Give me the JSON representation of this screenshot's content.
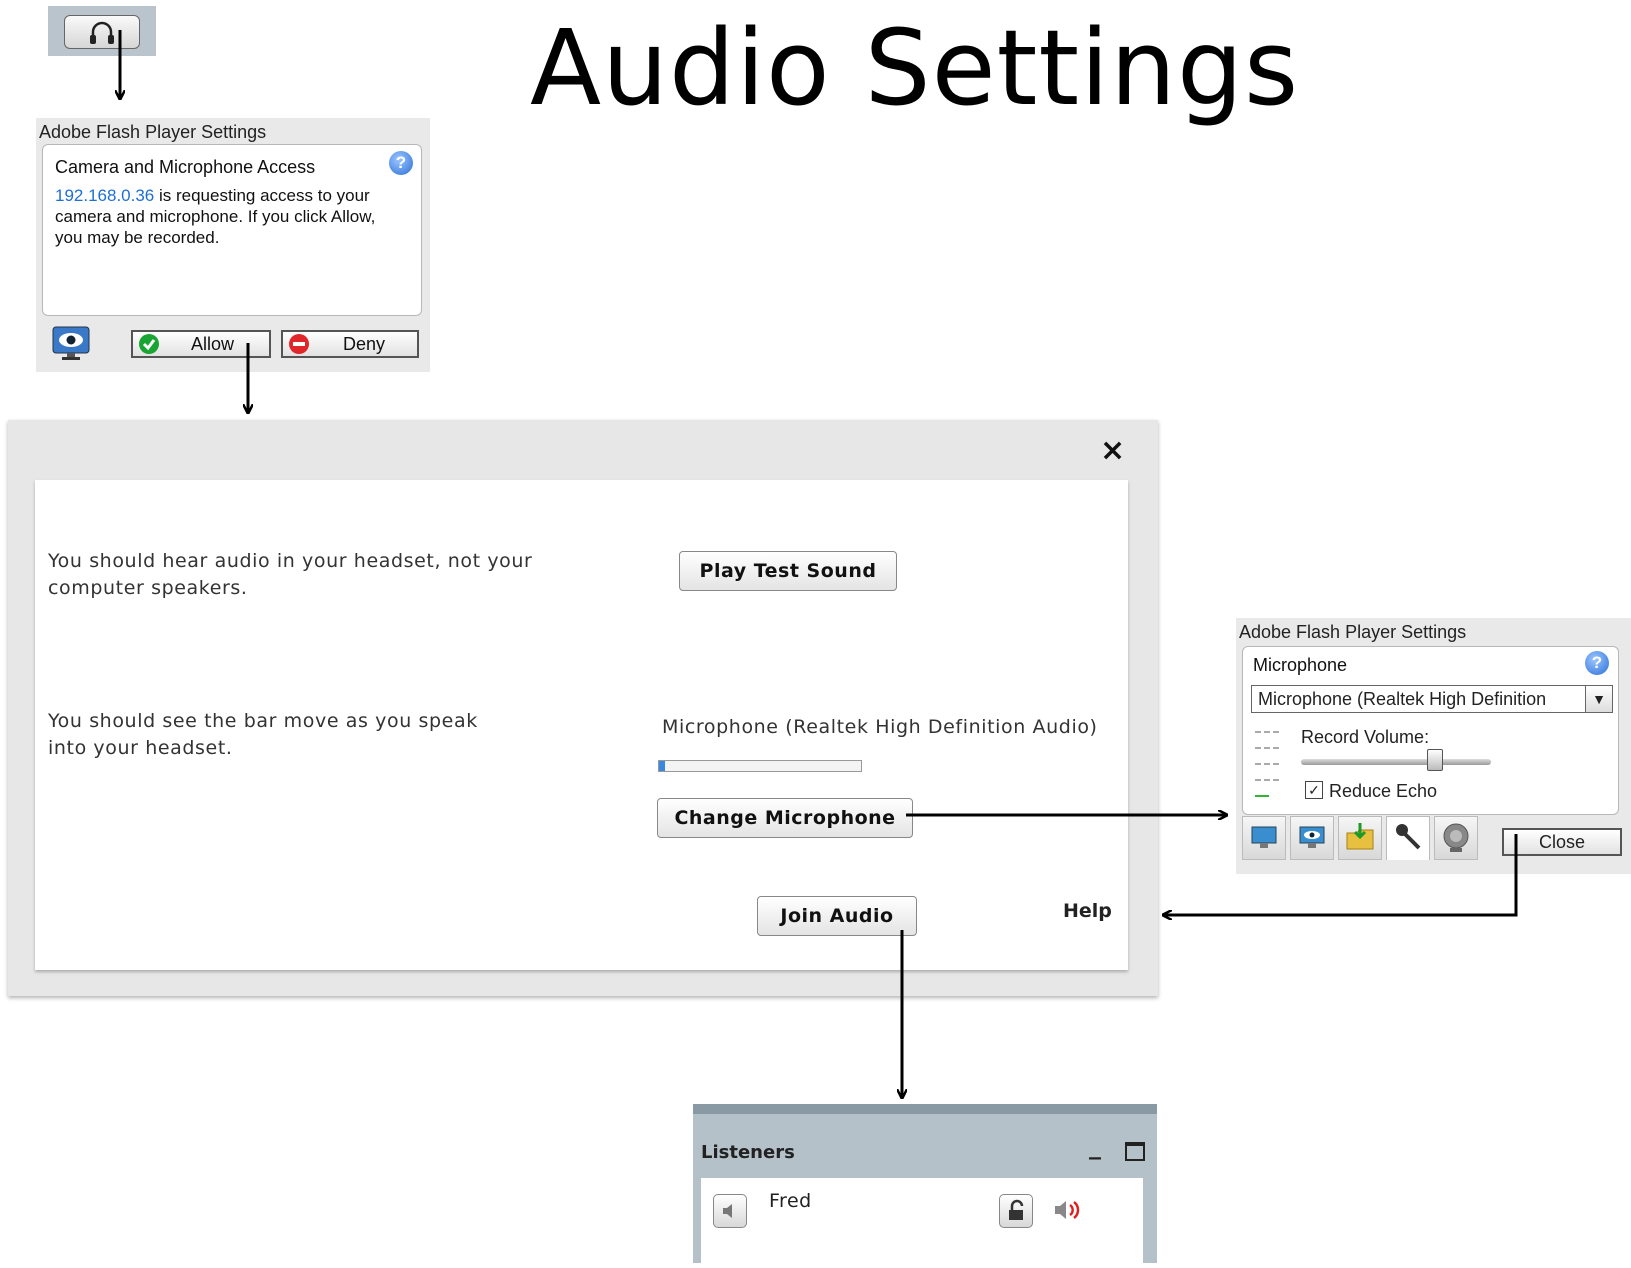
{
  "page": {
    "title": "Audio Settings"
  },
  "flash_access_dialog": {
    "title": "Adobe Flash Player Settings",
    "heading": "Camera and Microphone Access",
    "ip": "192.168.0.36",
    "message_rest": " is requesting access to your camera and microphone. If you click Allow, you may be recorded.",
    "allow_label": "Allow",
    "deny_label": "Deny"
  },
  "audio_dialog": {
    "close_symbol": "×",
    "headset_instruction": "You should hear audio in your headset, not your computer speakers.",
    "play_test_label": "Play Test Sound",
    "speak_instruction": "You should see the bar move as you speak into your headset.",
    "microphone_name": "Microphone (Realtek High Definition Audio)",
    "mic_level": 0.03,
    "change_mic_label": "Change Microphone",
    "join_audio_label": "Join Audio",
    "help_label": "Help"
  },
  "flash_mic_dialog": {
    "title": "Adobe Flash Player Settings",
    "heading": "Microphone",
    "selected_microphone": "Microphone (Realtek High Definition",
    "record_volume_label": "Record Volume:",
    "record_volume": 0.7,
    "reduce_echo_label": "Reduce Echo",
    "reduce_echo_checked": true,
    "close_label": "Close",
    "tabs": [
      "display-icon",
      "privacy-icon",
      "storage-icon",
      "microphone-icon",
      "camera-icon"
    ]
  },
  "listeners_panel": {
    "title": "Listeners",
    "minimize_symbol": "_",
    "listeners": [
      {
        "name": "Fred"
      }
    ]
  },
  "colors": {
    "link_blue": "#1d6fd6",
    "panel_header": "#b4c1c9",
    "level_fill": "#3a86e0"
  }
}
